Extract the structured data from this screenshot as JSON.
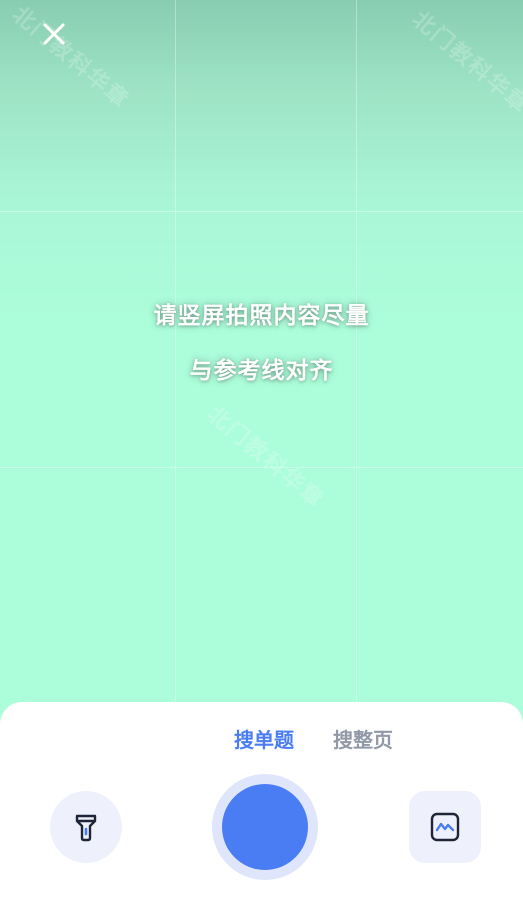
{
  "camera": {
    "guide_line_1": "请竖屏拍照内容尽量",
    "guide_line_2": "与参考线对齐",
    "watermark_text": "北门教科华章"
  },
  "modes": {
    "single_question": "搜单题",
    "whole_page": "搜整页",
    "selected": "single_question"
  },
  "colors": {
    "accent": "#4a7cf3",
    "inactive_tab": "#9198a8",
    "camera_bg": "#acfdda",
    "button_bg": "#eef1fb"
  },
  "icons": {
    "close": "close-icon",
    "flashlight": "flashlight-icon",
    "album": "album-icon"
  }
}
